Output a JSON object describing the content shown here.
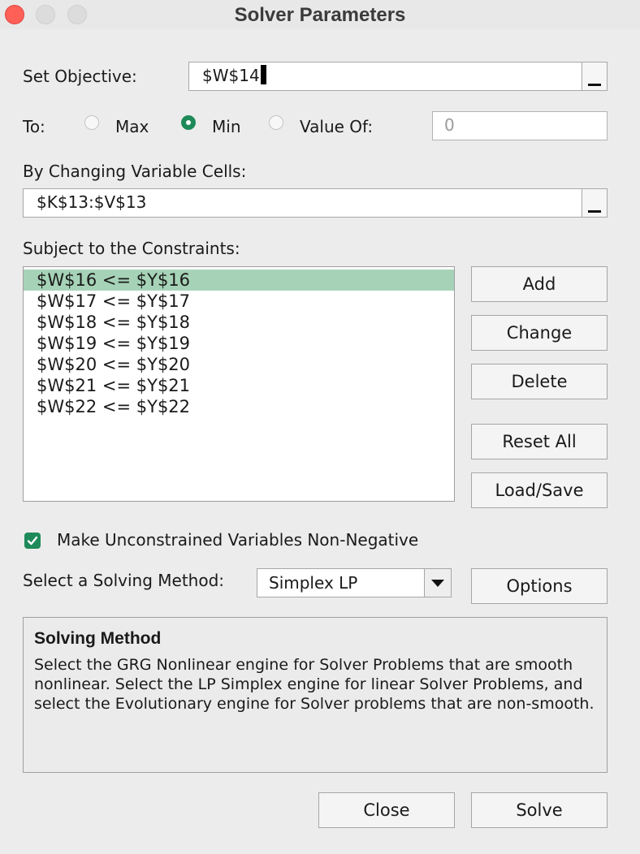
{
  "window": {
    "title": "Solver Parameters"
  },
  "objective": {
    "label": "Set Objective:",
    "value": "$W$14"
  },
  "to": {
    "label": "To:",
    "options": [
      {
        "label": "Max",
        "selected": false
      },
      {
        "label": "Min",
        "selected": true
      },
      {
        "label": "Value Of:",
        "selected": false
      }
    ],
    "value_of": "0"
  },
  "variables": {
    "label": "By Changing Variable Cells:",
    "value": "$K$13:$V$13"
  },
  "constraints": {
    "label": "Subject to the Constraints:",
    "items": [
      "$W$16 <= $Y$16",
      "$W$17 <= $Y$17",
      "$W$18 <= $Y$18",
      "$W$19 <= $Y$19",
      "$W$20 <= $Y$20",
      "$W$21 <= $Y$21",
      "$W$22 <= $Y$22"
    ],
    "selected_index": 0,
    "buttons": {
      "add": "Add",
      "change": "Change",
      "delete": "Delete",
      "reset_all": "Reset All",
      "load_save": "Load/Save"
    }
  },
  "nonneg": {
    "label": "Make Unconstrained Variables Non-Negative",
    "checked": true
  },
  "method": {
    "label": "Select a Solving Method:",
    "selected": "Simplex LP",
    "options_button": "Options"
  },
  "description": {
    "title": "Solving Method",
    "text": "Select the GRG Nonlinear engine for Solver Problems that are smooth nonlinear. Select the LP Simplex engine for linear Solver Problems, and select the Evolutionary engine for Solver problems that are non-smooth."
  },
  "footer": {
    "close": "Close",
    "solve": "Solve"
  },
  "colors": {
    "accent": "#1e8a5a",
    "selection": "#a6d3b7",
    "close_light": "#fe5f57"
  }
}
